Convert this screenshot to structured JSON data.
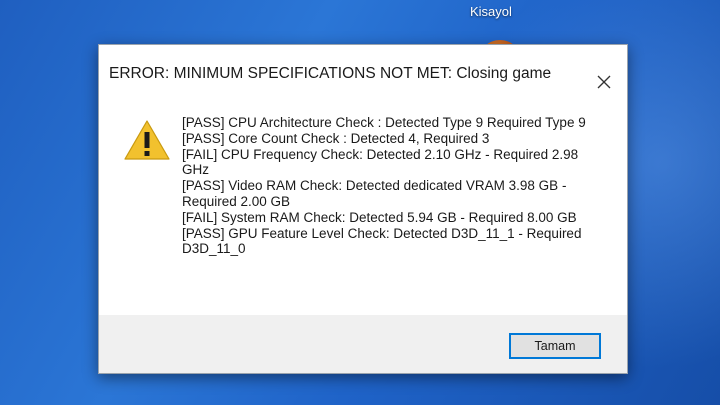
{
  "desktop": {
    "shortcut_label": "Kisayol"
  },
  "dialog": {
    "title": "ERROR: MINIMUM SPECIFICATIONS NOT MET: Closing game",
    "icon": "warning-icon",
    "lines": [
      "[PASS] CPU Architecture Check : Detected Type 9 Required Type 9",
      "[PASS] Core Count Check : Detected 4, Required 3",
      "[FAIL] CPU Frequency Check: Detected 2.10 GHz - Required 2.98 GHz",
      "[PASS] Video RAM Check: Detected dedicated VRAM 3.98 GB - Required 2.00 GB",
      "[FAIL] System RAM Check: Detected 5.94 GB - Required 8.00 GB",
      "[PASS] GPU Feature Level Check: Detected D3D_11_1 - Required D3D_11_0"
    ],
    "ok_label": "Tamam"
  },
  "colors": {
    "accent": "#0078d7",
    "warning": "#f2c12e"
  }
}
